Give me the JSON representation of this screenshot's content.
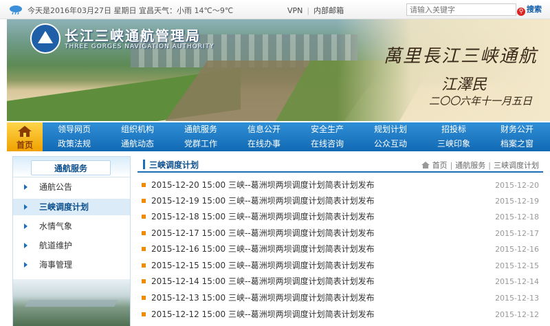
{
  "topbar": {
    "weather": "今天是2016年03月27日  星期日  宜昌天气：小雨 14℃～9℃",
    "links": [
      "VPN",
      "内部邮箱"
    ],
    "search_placeholder": "请输入关键字",
    "search_label": "搜索"
  },
  "banner": {
    "org_name": "长江三峡通航管理局",
    "org_name_en": "THREE GORGES NAVIGATION AUTHORITY",
    "calligraphy_line1": "萬里長江三峡通航",
    "calligraphy_line2": "江澤民",
    "calligraphy_line3": "二〇〇六年十一月五日"
  },
  "nav": {
    "home_label": "首页",
    "row1": [
      "领导网页",
      "组织机构",
      "通航服务",
      "信息公开",
      "安全生产",
      "规划计划",
      "招投标",
      "财务公开"
    ],
    "row2": [
      "政策法规",
      "通航动态",
      "党群工作",
      "在线办事",
      "在线咨询",
      "公众互动",
      "三峡印象",
      "档案之窗"
    ]
  },
  "sidebar": {
    "title": "通航服务",
    "items": [
      "通航公告",
      "三峡调度计划",
      "水情气象",
      "航道维护",
      "海事管理"
    ],
    "active_index": 1
  },
  "main": {
    "title": "三峡调度计划",
    "breadcrumb": [
      "首页",
      "通航服务",
      "三峡调度计划"
    ],
    "items": [
      {
        "text": "2015-12-20 15:00 三峡--葛洲坝两坝调度计划简表计划发布",
        "date": "2015-12-20"
      },
      {
        "text": "2015-12-19 15:00 三峡--葛洲坝两坝调度计划简表计划发布",
        "date": "2015-12-19"
      },
      {
        "text": "2015-12-18 15:00 三峡--葛洲坝两坝调度计划简表计划发布",
        "date": "2015-12-18"
      },
      {
        "text": "2015-12-17 15:00 三峡--葛洲坝两坝调度计划简表计划发布",
        "date": "2015-12-17"
      },
      {
        "text": "2015-12-16 15:00 三峡--葛洲坝两坝调度计划简表计划发布",
        "date": "2015-12-16"
      },
      {
        "text": "2015-12-15 15:00 三峡--葛洲坝两坝调度计划简表计划发布",
        "date": "2015-12-15"
      },
      {
        "text": "2015-12-14 15:00 三峡--葛洲坝两坝调度计划简表计划发布",
        "date": "2015-12-14"
      },
      {
        "text": "2015-12-13 15:00 三峡--葛洲坝两坝调度计划简表计划发布",
        "date": "2015-12-13"
      },
      {
        "text": "2015-12-12 15:00 三峡--葛洲坝两坝调度计划简表计划发布",
        "date": "2015-12-12"
      }
    ]
  },
  "colors": {
    "nav_blue": "#1a6fb8",
    "home_yellow": "#f0a100",
    "bullet_orange": "#f08a00",
    "title_blue": "#0b4e8c"
  }
}
